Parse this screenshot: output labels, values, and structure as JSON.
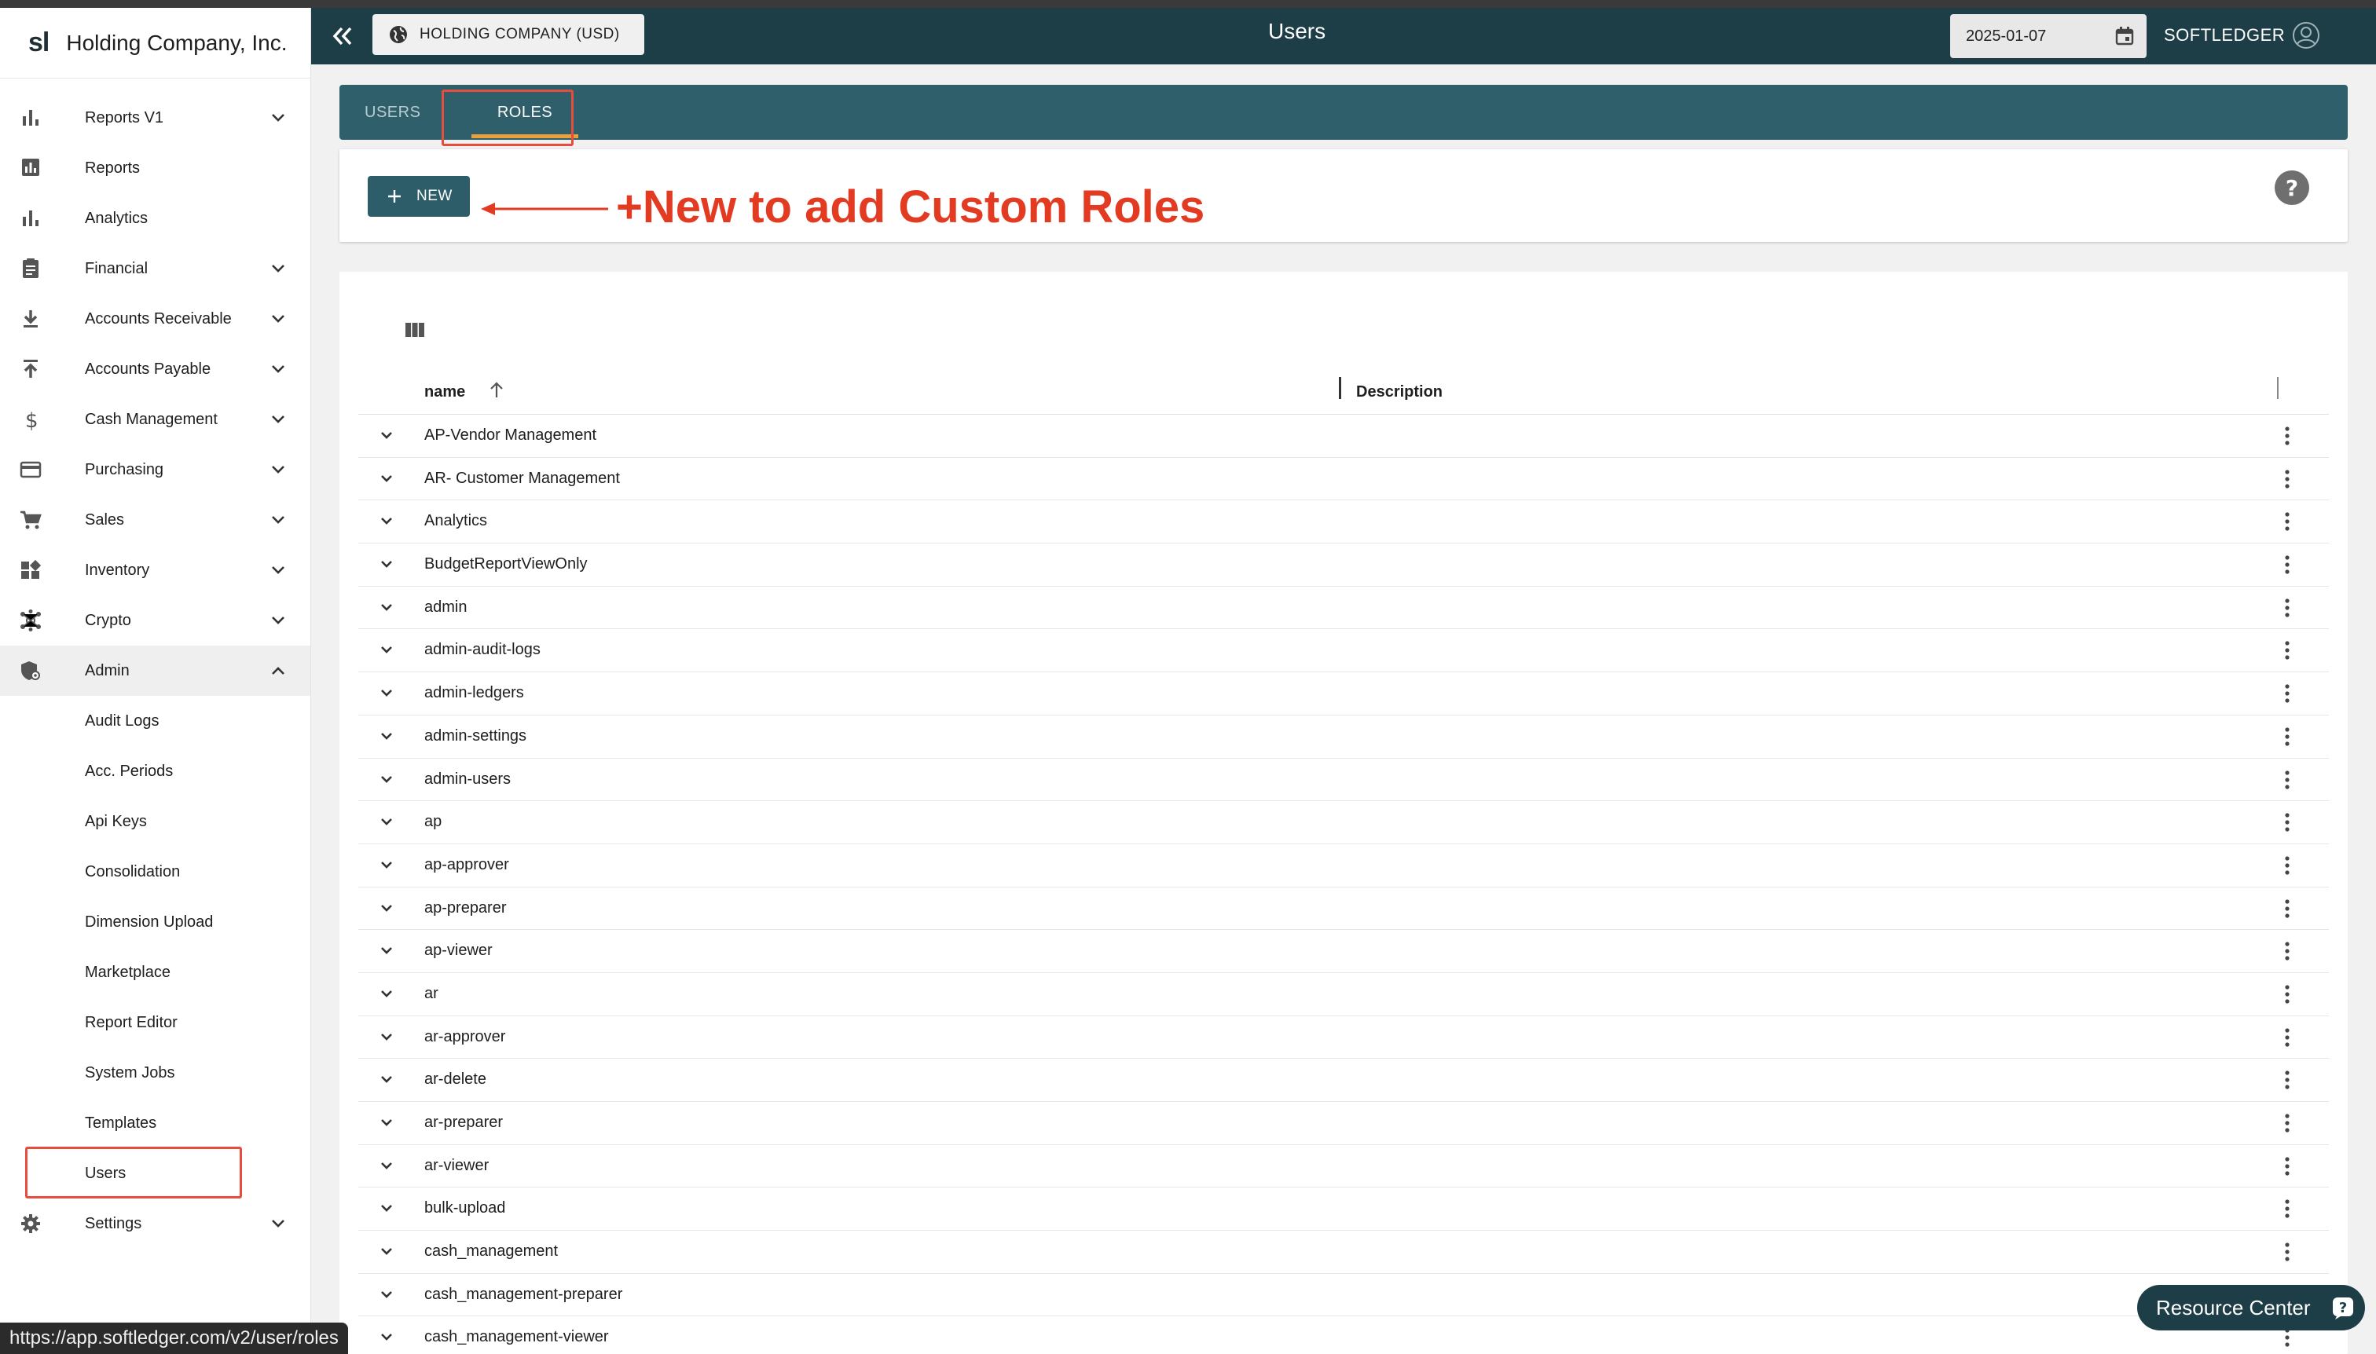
{
  "brand": {
    "logo": "sl",
    "company": "Holding Company, Inc."
  },
  "sidebar": {
    "items": [
      {
        "label": "Reports V1",
        "icon": "bar-chart-icon",
        "expandable": true
      },
      {
        "label": "Reports",
        "icon": "report-icon",
        "expandable": false
      },
      {
        "label": "Analytics",
        "icon": "analytics-icon",
        "expandable": false
      },
      {
        "label": "Financial",
        "icon": "clipboard-icon",
        "expandable": true
      },
      {
        "label": "Accounts Receivable",
        "icon": "download-icon",
        "expandable": true
      },
      {
        "label": "Accounts Payable",
        "icon": "upload-icon",
        "expandable": true
      },
      {
        "label": "Cash Management",
        "icon": "dollar-icon",
        "expandable": true
      },
      {
        "label": "Purchasing",
        "icon": "credit-card-icon",
        "expandable": true
      },
      {
        "label": "Sales",
        "icon": "cart-icon",
        "expandable": true
      },
      {
        "label": "Inventory",
        "icon": "dashboard-icon",
        "expandable": true
      },
      {
        "label": "Crypto",
        "icon": "network-icon",
        "expandable": true
      },
      {
        "label": "Admin",
        "icon": "admin-shield-icon",
        "expandable": true,
        "expanded": true
      }
    ],
    "admin_sub_items": [
      "Audit Logs",
      "Acc. Periods",
      "Api Keys",
      "Consolidation",
      "Dimension Upload",
      "Marketplace",
      "Report Editor",
      "System Jobs",
      "Templates",
      "Users"
    ],
    "settings": {
      "label": "Settings",
      "icon": "gear-icon"
    }
  },
  "header": {
    "company_button": "HOLDING COMPANY (USD)",
    "title": "Users",
    "date": "2025-01-07",
    "user": "SOFTLEDGER"
  },
  "tabs": [
    {
      "label": "USERS",
      "active": false
    },
    {
      "label": "ROLES",
      "active": true
    }
  ],
  "toolbar": {
    "new_label": "NEW"
  },
  "annotation": {
    "text": "+New to add Custom Roles",
    "color": "#e23b22"
  },
  "table": {
    "columns": [
      "name",
      "Description"
    ],
    "rows": [
      "AP-Vendor Management",
      "AR- Customer Management",
      "Analytics",
      "BudgetReportViewOnly",
      "admin",
      "admin-audit-logs",
      "admin-ledgers",
      "admin-settings",
      "admin-users",
      "ap",
      "ap-approver",
      "ap-preparer",
      "ap-viewer",
      "ar",
      "ar-approver",
      "ar-delete",
      "ar-preparer",
      "ar-viewer",
      "bulk-upload",
      "cash_management",
      "cash_management-preparer",
      "cash_management-viewer"
    ]
  },
  "status_url": "https://app.softledger.com/v2/user/roles",
  "resource_center": {
    "label": "Resource Center"
  },
  "colors": {
    "header": "#1d3d47",
    "tabs_bar": "#2f5f6b",
    "accent": "#e9a23b",
    "highlight": "#e74c3c"
  }
}
